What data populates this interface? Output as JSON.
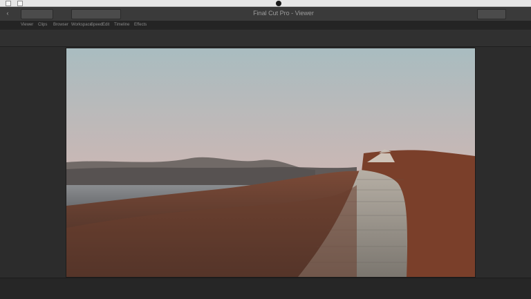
{
  "window": {
    "title": "Final Cut Pro - Viewer"
  },
  "menu": {
    "items": [
      "Viewer",
      "Clips",
      "Browser",
      "Workspace",
      "Speed",
      "Edit",
      "Timeline",
      "Effects"
    ]
  },
  "icons": {
    "camera": "webcam-dot-icon",
    "window_small_left_1": "small-window-icon",
    "window_small_left_2": "small-window-icon"
  },
  "viewer": {
    "image_subject": "sunset-boardwalk-hillside"
  },
  "colors": {
    "sky_top": "#a9bcc0",
    "sky_mid": "#cbb7b4",
    "sky_horizon": "#d8a497",
    "hills_dark": "#5a4b47",
    "road": "#9f998f",
    "grass_warm": "#8a4d30"
  }
}
